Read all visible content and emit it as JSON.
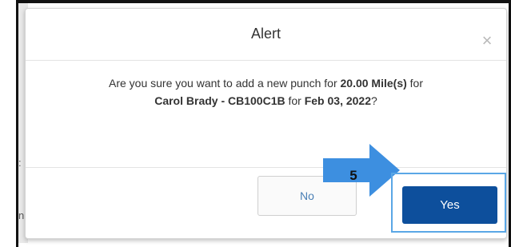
{
  "dialog": {
    "title": "Alert",
    "close_symbol": "×",
    "message": {
      "line1_prefix": "Are you sure you want to add a new punch for ",
      "amount": "20.00 Mile(s)",
      "line1_suffix": " for",
      "employee": "Carol Brady - CB100C1B",
      "line2_mid": " for ",
      "date": "Feb 03, 2022",
      "line2_end": "?"
    },
    "no_label": "No",
    "yes_label": "Yes"
  },
  "annotation": {
    "step_number": "5",
    "arrow_color": "#3d8fe0",
    "highlight_color": "#5aa7e6"
  },
  "background": {
    "edge_char_1": ":",
    "edge_char_2": "n"
  },
  "colors": {
    "yes_button": "#0d4f9c",
    "no_text": "#4a7fb5"
  }
}
